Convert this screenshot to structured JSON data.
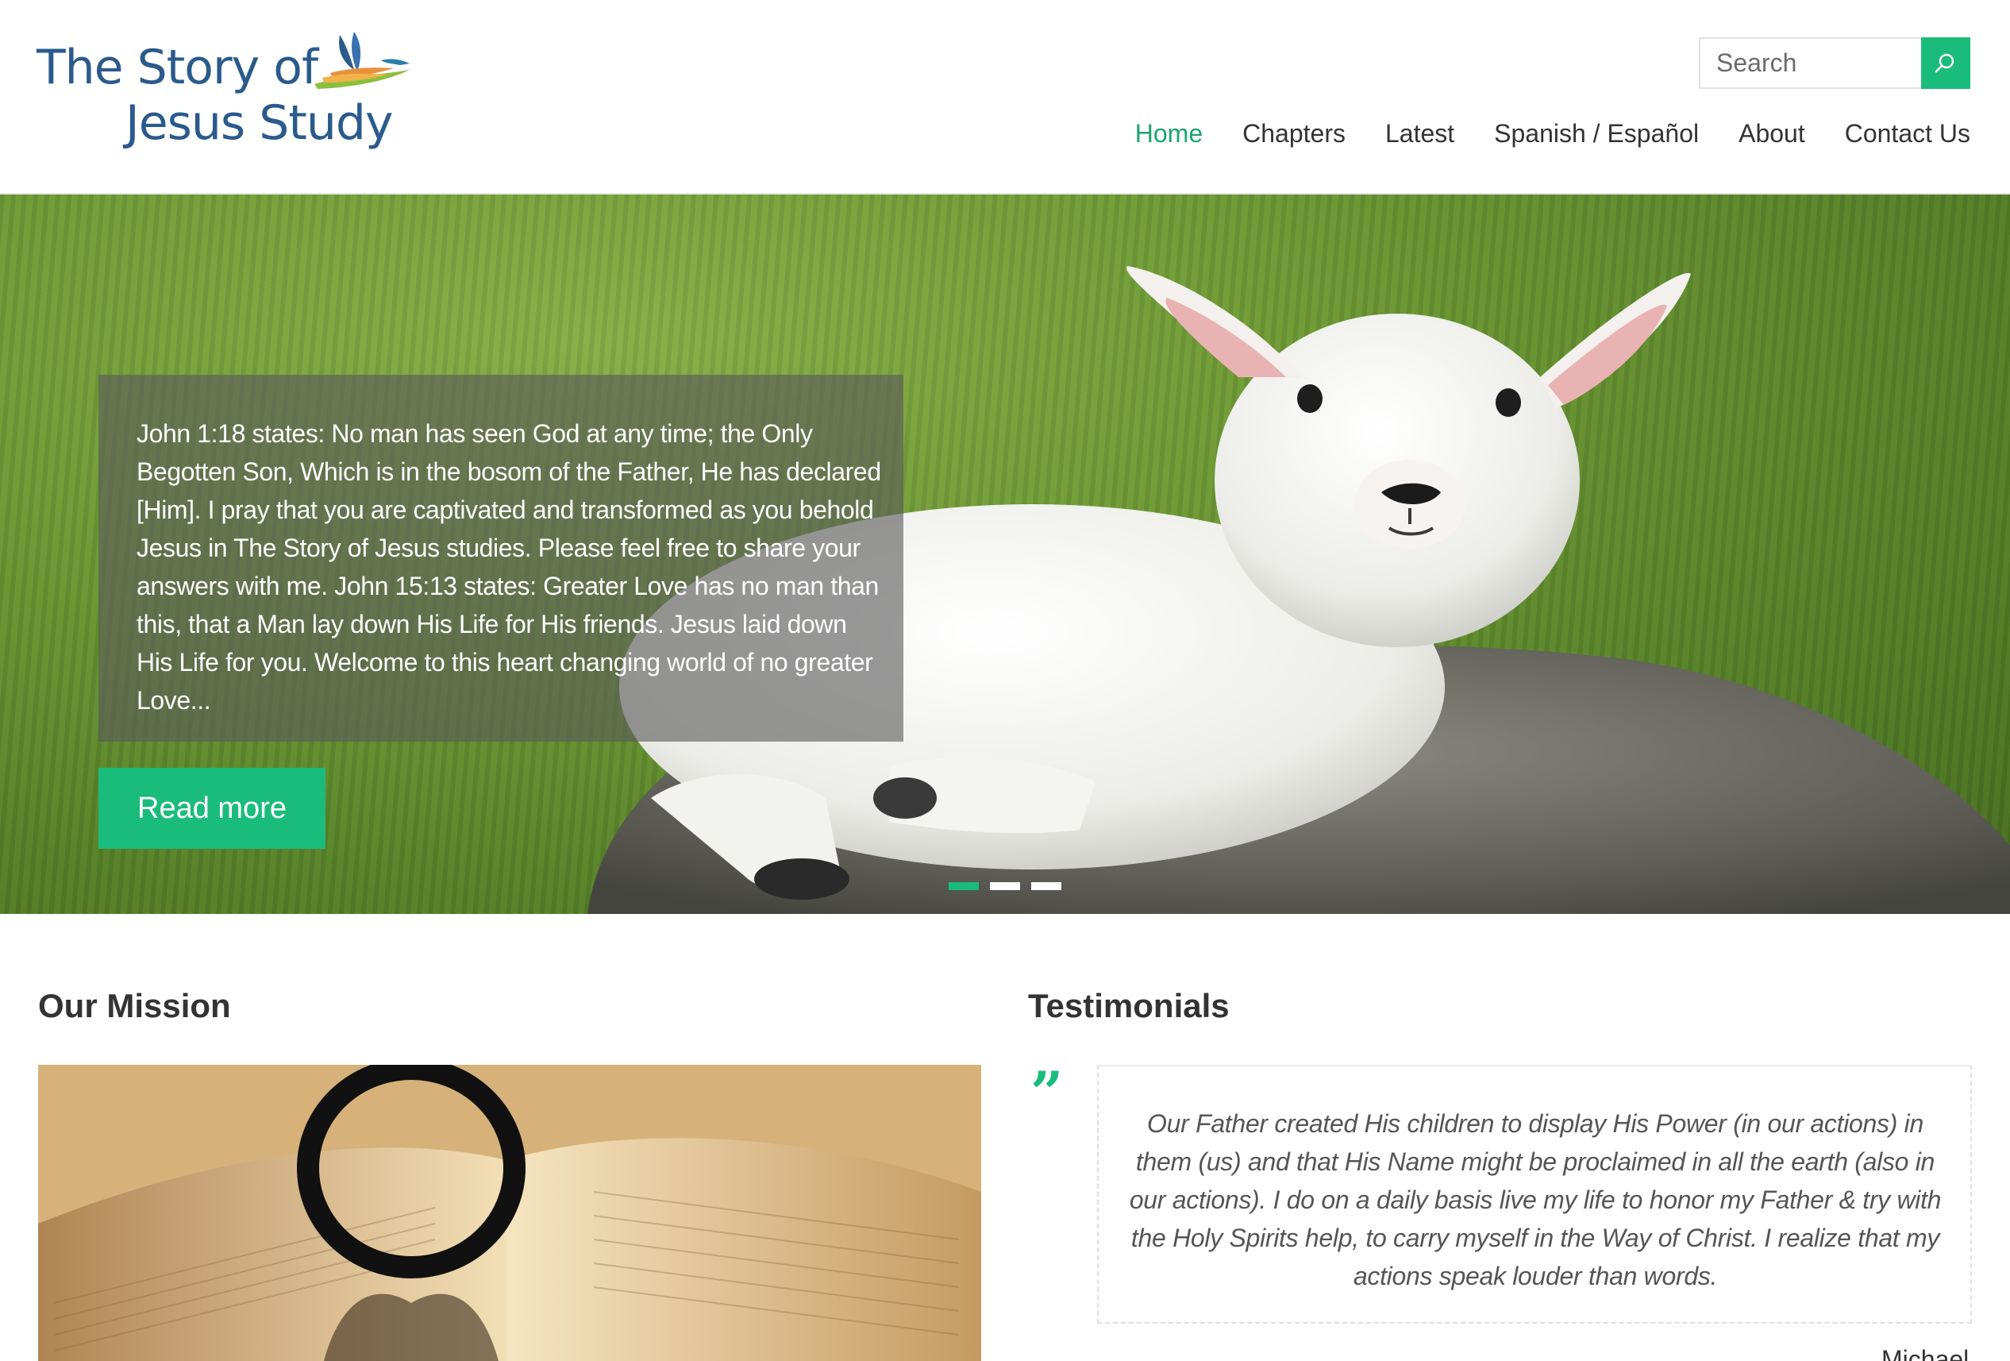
{
  "brand": {
    "line1": "The Story of",
    "line2": "Jesus Study"
  },
  "search": {
    "placeholder": "Search"
  },
  "nav": {
    "items": [
      {
        "label": "Home",
        "active": true
      },
      {
        "label": "Chapters"
      },
      {
        "label": "Latest"
      },
      {
        "label": "Spanish / Español"
      },
      {
        "label": "About"
      },
      {
        "label": "Contact Us"
      }
    ]
  },
  "hero": {
    "caption": "John 1:18 states: No man has seen God at any time; the Only Begotten Son, Which is in the bosom of the Father, He has declared [Him]. I pray that you are captivated and transformed as you behold Jesus in The Story of Jesus studies. Please feel free to share your answers with me. John 15:13 states: Greater Love has no man than this, that a Man lay down His Life for His friends. Jesus laid down His Life for you. Welcome to this heart changing world of no greater Love...",
    "button_label": "Read more",
    "slide_count": 3,
    "active_slide": 1
  },
  "mission": {
    "title": "Our Mission"
  },
  "testimonials": {
    "title": "Testimonials",
    "quote_mark": "”",
    "quote": "Our Father created His children to display His Power (in our actions) in them (us) and that His Name might be proclaimed in all the earth (also in our actions). I do on a daily basis live my life to honor my Father & try with the Holy Spirits help, to carry myself in the Way of Christ. I realize that my actions speak louder than words.",
    "author": "Michael"
  },
  "colors": {
    "accent": "#1abc7b",
    "nav_active": "#1aa56e",
    "logo_blue": "#2b5a8c"
  }
}
